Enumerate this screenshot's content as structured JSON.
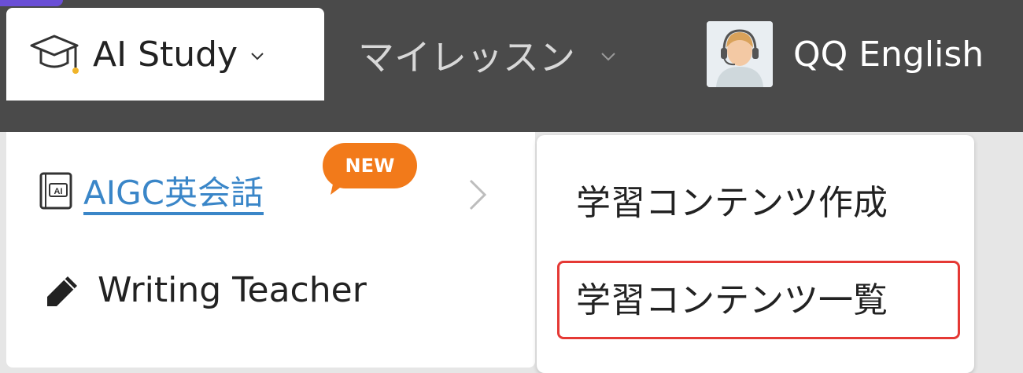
{
  "header": {
    "ai_study_label": "AI Study",
    "my_lessons_label": "マイレッスン",
    "profile_name": "QQ English",
    "icons": {
      "ai_study": "graduation-cap-icon",
      "dropdown": "chevron-down-icon",
      "avatar": "teacher-avatar"
    }
  },
  "menu": {
    "aigc_label": "AIGC英会話",
    "aigc_badge": "NEW",
    "writing_label": "Writing Teacher",
    "icons": {
      "aigc": "ai-book-icon",
      "writing": "pencil-icon",
      "submenu": "chevron-right-icon"
    }
  },
  "submenu": {
    "create_label": "学習コンテンツ作成",
    "list_label": "学習コンテンツ一覧",
    "highlighted": "list_label"
  },
  "colors": {
    "header_bg": "#4a4a4a",
    "link_blue": "#3a86c8",
    "badge_orange": "#f27a1a",
    "highlight_red": "#e53935"
  }
}
